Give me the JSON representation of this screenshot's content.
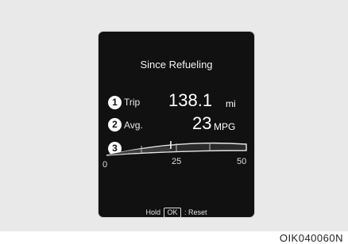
{
  "display": {
    "title": "Since Refueling",
    "trip": {
      "marker": "1",
      "label": "Trip",
      "value": "138.1",
      "unit": "mi"
    },
    "avg": {
      "marker": "2",
      "label": "Avg.",
      "value": "23",
      "unit": "MPG"
    },
    "gauge": {
      "marker": "3",
      "min_label": "0",
      "mid_label": "25",
      "max_label": "50",
      "level_mpg": 23
    },
    "hint": {
      "prefix": "Hold",
      "key": "OK",
      "suffix": ": Reset"
    }
  },
  "figure_code": "OIK040060N",
  "colors": {
    "screen": "#111111",
    "frame": "#e9e9e9",
    "text": "#ffffff"
  }
}
